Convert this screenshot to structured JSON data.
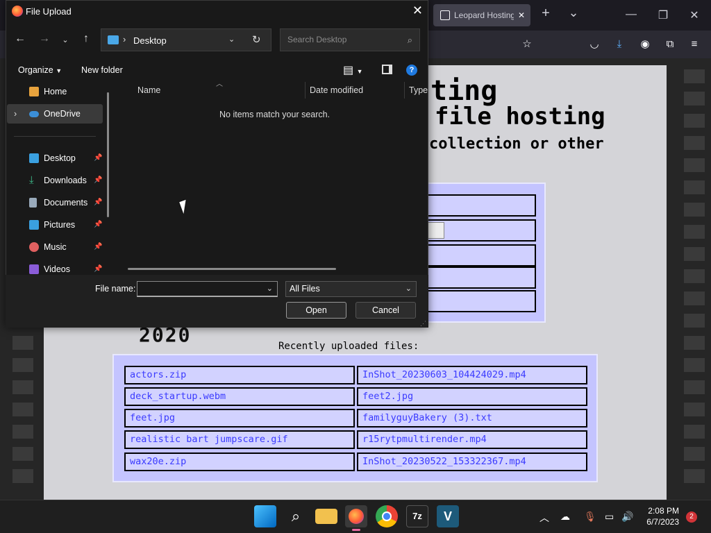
{
  "browser": {
    "tab_title": "Leopard Hosting",
    "tab_close": "✕",
    "new_tab": "+",
    "tab_list": "⌄",
    "minimize": "—",
    "restore": "❐",
    "close": "✕"
  },
  "webpage": {
    "heading_line1": "ting",
    "heading_line2": "file hosting",
    "heading_line3": "collection or other",
    "logo_fragment": "2020",
    "recent_label": "Recently uploaded files:",
    "files": [
      [
        "actors.zip",
        "InShot_20230603_104424029.mp4"
      ],
      [
        "deck_startup.webm",
        "feet2.jpg"
      ],
      [
        "feet.jpg",
        "familyguyBakery (3).txt"
      ],
      [
        "realistic bart jumpscare.gif",
        "r15rytpmultirender.mp4"
      ],
      [
        "wax20e.zip",
        "InShot_20230522_153322367.mp4"
      ]
    ]
  },
  "dialog": {
    "title": "File Upload",
    "address": {
      "location": "Desktop"
    },
    "search_placeholder": "Search Desktop",
    "organize": "Organize",
    "new_folder": "New folder",
    "nav": [
      {
        "label": "Home",
        "icon": "home-icon",
        "color": "#e8a33d",
        "pinned": false
      },
      {
        "label": "OneDrive",
        "icon": "cloud-icon",
        "color": "#3b8fd8",
        "pinned": false,
        "selected": true,
        "expand": "›"
      },
      {
        "label": "Desktop",
        "icon": "desktop-icon",
        "color": "#3aa0e0",
        "pinned": true
      },
      {
        "label": "Downloads",
        "icon": "download-icon",
        "color": "#3dbb8a",
        "pinned": true
      },
      {
        "label": "Documents",
        "icon": "document-icon",
        "color": "#9ab",
        "pinned": true
      },
      {
        "label": "Pictures",
        "icon": "picture-icon",
        "color": "#3aa0e0",
        "pinned": true
      },
      {
        "label": "Music",
        "icon": "music-icon",
        "color": "#e06060",
        "pinned": true
      },
      {
        "label": "Videos",
        "icon": "video-icon",
        "color": "#8a5cd8",
        "pinned": true
      }
    ],
    "columns": [
      "Name",
      "Date modified",
      "Type"
    ],
    "empty_message": "No items match your search.",
    "file_name_label": "File name:",
    "file_name_value": "",
    "filter_value": "All Files",
    "open": "Open",
    "cancel": "Cancel"
  },
  "taskbar": {
    "clock_time": "2:08 PM",
    "clock_date": "6/7/2023",
    "notification_count": "2",
    "apps": [
      "windows-start-icon",
      "search-icon",
      "file-explorer-icon",
      "firefox-icon",
      "chrome-icon",
      "7zip-icon",
      "vegas-icon"
    ]
  }
}
